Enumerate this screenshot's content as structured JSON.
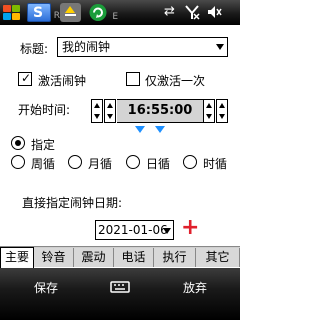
{
  "statusbar": {
    "app1_glyph": "S",
    "app1_badge": "R",
    "app2_icon": "recycle-icon",
    "app3_badge": "E",
    "right_icons": [
      "connectivity-arrows-icon",
      "signal-icon",
      "speaker-muted-icon"
    ],
    "right_glyphs": [
      "⇄",
      "Y",
      "◁×"
    ]
  },
  "form": {
    "title_label": "标题:",
    "title_value": "我的闹钟",
    "activate_label": "激活闹钟",
    "activate_checked": true,
    "once_label": "仅激活一次",
    "once_checked": false,
    "start_time_label": "开始时间:",
    "start_time_value": "16:55:00",
    "specified_label": "指定",
    "repeat_options": [
      "周循",
      "月循",
      "日循",
      "时循"
    ],
    "selected_option": "指定",
    "date_label": "直接指定闹钟日期:",
    "date_value": "2021-01-06",
    "add_date_glyph": "+"
  },
  "tabs": [
    {
      "label": "主要",
      "active": true
    },
    {
      "label": "铃音",
      "active": false
    },
    {
      "label": "震动",
      "active": false
    },
    {
      "label": "电话",
      "active": false
    },
    {
      "label": "执行",
      "active": false
    },
    {
      "label": "其它",
      "active": false
    }
  ],
  "softkeys": {
    "left": "保存",
    "right": "放弃",
    "center_icon": "keyboard-icon"
  },
  "colors": {
    "accent_blue": "#1e90ff",
    "add_red": "#e0202c"
  }
}
